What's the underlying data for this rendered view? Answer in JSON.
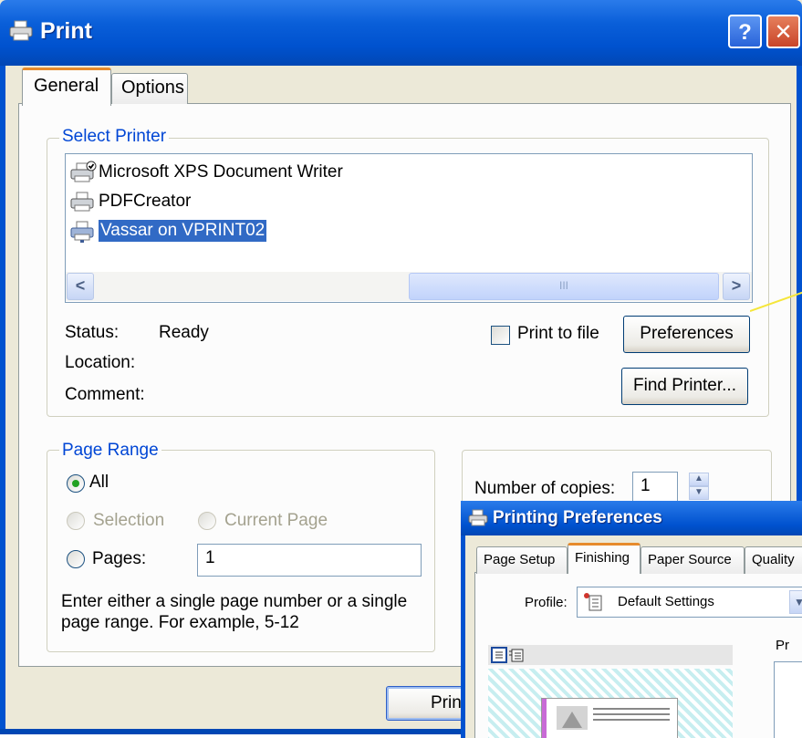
{
  "print_dialog": {
    "title": "Print",
    "tabs": [
      {
        "label": "General",
        "active": true
      },
      {
        "label": "Options",
        "active": false
      }
    ],
    "select_printer": {
      "legend": "Select Printer",
      "printers": [
        {
          "name": "Microsoft XPS Document Writer",
          "icon": "printer-default-icon",
          "selected": false
        },
        {
          "name": "PDFCreator",
          "icon": "printer-icon",
          "selected": false
        },
        {
          "name": "Vassar on VPRINT02",
          "icon": "network-printer-icon",
          "selected": true
        }
      ],
      "scrollbar_grip": "III",
      "status_label": "Status:",
      "status_value": "Ready",
      "location_label": "Location:",
      "comment_label": "Comment:",
      "print_to_file_label": "Print to file",
      "print_to_file_checked": false,
      "preferences_button": "Preferences",
      "find_printer_button": "Find Printer..."
    },
    "page_range": {
      "legend": "Page Range",
      "all_label": "All",
      "selection_label": "Selection",
      "current_page_label": "Current Page",
      "pages_label": "Pages:",
      "pages_value": "1",
      "selected_option": "All",
      "help_text": "Enter either a single page number or a single page range.  For example, 5-12"
    },
    "copies": {
      "label": "Number of copies:",
      "value": "1"
    },
    "print_button": "Prin"
  },
  "preferences_dialog": {
    "title": "Printing Preferences",
    "tabs": [
      {
        "label": "Page Setup",
        "active": false
      },
      {
        "label": "Finishing",
        "active": true
      },
      {
        "label": "Paper Source",
        "active": false
      },
      {
        "label": "Quality",
        "active": false
      }
    ],
    "profile_label": "Profile:",
    "profile_value": "Default Settings",
    "right_label_partial": "Pr"
  },
  "colors": {
    "titlebar_blue": "#0052cf",
    "selection_blue": "#316ac5",
    "group_legend_blue": "#0046d5",
    "tab_highlight_orange": "#e68b2c",
    "callout_line": "#f5e63a"
  }
}
